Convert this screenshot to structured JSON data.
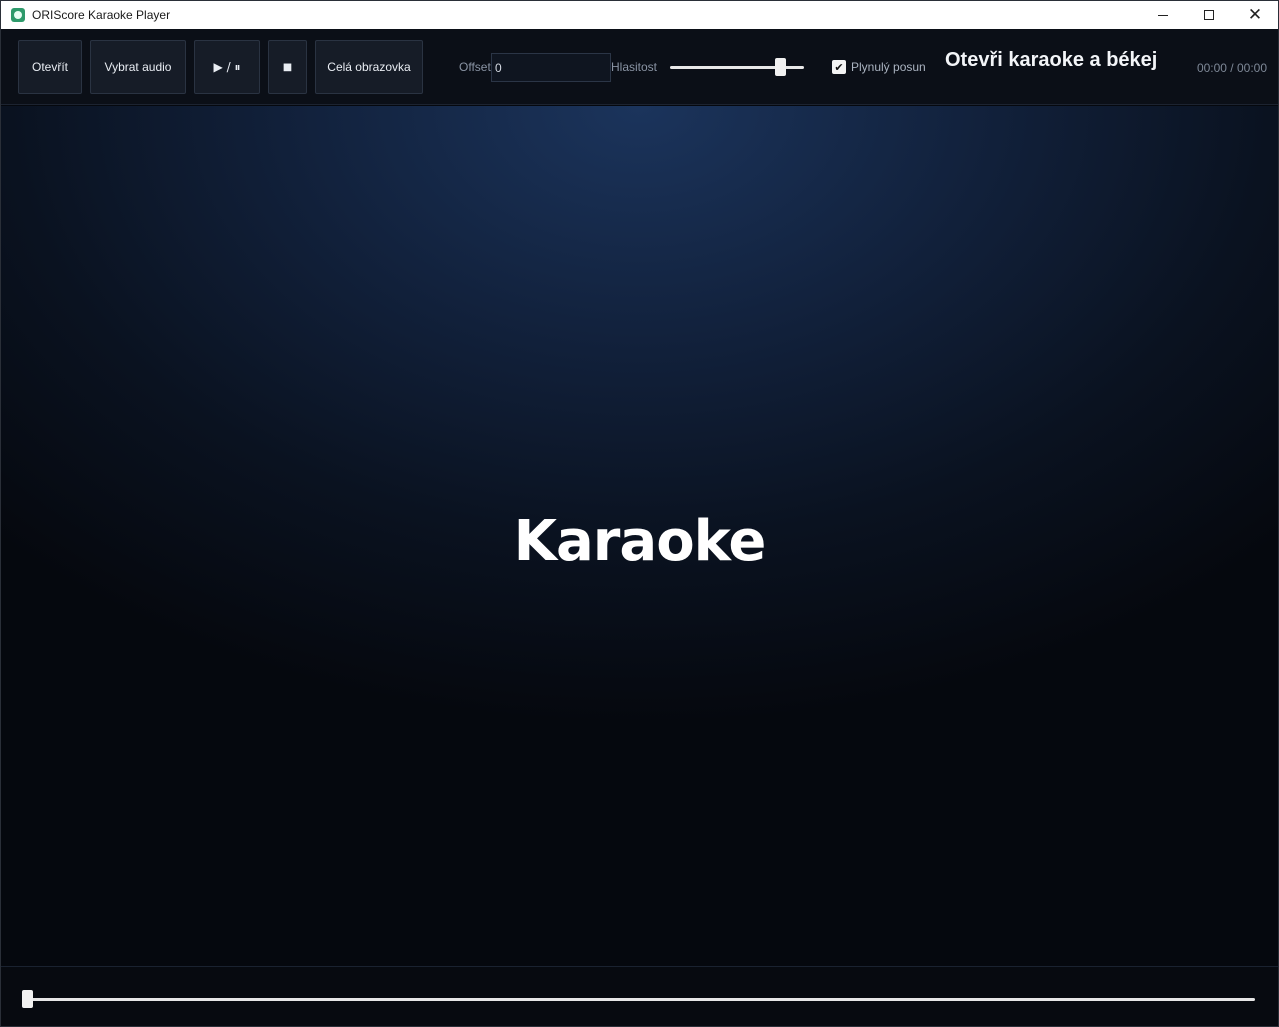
{
  "window": {
    "title": "ORIScore Karaoke Player",
    "controls": {
      "minimize": "",
      "maximize": "",
      "close": "✕"
    }
  },
  "toolbar": {
    "open_label": "Otevřít",
    "audio_label": "Vybrat audio",
    "playpause_label": "▶ / ⏸",
    "stop_label": "■",
    "fullscreen_label": "Celá obrazovka",
    "offset_label": "Offset",
    "offset_value": "0",
    "volume_label": "Hlasitost",
    "volume_level": 0.85,
    "smooth_label": "Plynulý posun",
    "smooth_checked": true,
    "status": "Otevři karaoke a békej",
    "time": "00:00 / 00:00"
  },
  "stage": {
    "lyric": "Karaoke"
  },
  "seek": {
    "position": 0
  },
  "colors": {
    "background": "#05080e",
    "toolbar": "#0b0f17",
    "button": "#161c27",
    "stage_glow": "#1b345c"
  }
}
